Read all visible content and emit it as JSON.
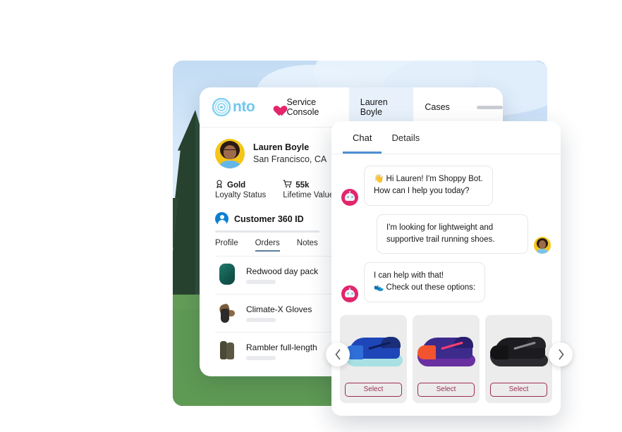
{
  "app": {
    "logo_text": "nto",
    "header_tabs": [
      {
        "label": "Service Console",
        "icon": "heart-icon",
        "active": false
      },
      {
        "label": "Lauren Boyle",
        "active": true
      },
      {
        "label": "Cases",
        "active": false
      }
    ]
  },
  "customer": {
    "name": "Lauren Boyle",
    "location": "San Francisco, CA",
    "stats": [
      {
        "icon": "badge-icon",
        "value": "Gold",
        "label": "Loyalty Status"
      },
      {
        "icon": "cart-icon",
        "value": "55k",
        "label": "Lifetime Value"
      }
    ],
    "section_title": "Customer 360 ID",
    "subtabs": [
      {
        "label": "Profile",
        "active": false
      },
      {
        "label": "Orders",
        "active": true
      },
      {
        "label": "Notes",
        "active": false
      }
    ],
    "orders": [
      {
        "name": "Redwood day pack",
        "thumb": "backpack-thumb"
      },
      {
        "name": "Climate-X Gloves",
        "thumb": "gloves-thumb"
      },
      {
        "name": "Rambler full-length",
        "thumb": "boots-thumb"
      }
    ]
  },
  "chat": {
    "tabs": [
      {
        "label": "Chat",
        "active": true
      },
      {
        "label": "Details",
        "active": false
      }
    ],
    "messages": [
      {
        "from": "bot",
        "text": "👋 Hi Lauren! I'm Shoppy Bot.\nHow can I help you today?"
      },
      {
        "from": "user",
        "text": "I'm looking for lightweight and supportive trail running shoes."
      },
      {
        "from": "bot",
        "text": "I can help with that!\n👟 Check out these options:"
      }
    ],
    "products": [
      {
        "name": "blue-trail-shoe",
        "select_label": "Select",
        "colors": {
          "sole": "#a8e0e4",
          "upper": "#1f46b8",
          "toe": "#2f6fd8",
          "collar": "#1a2e7a",
          "lace": "#0e1e5c"
        }
      },
      {
        "name": "purple-orange-trail-shoe",
        "select_label": "Select",
        "colors": {
          "sole": "#6a2fa0",
          "upper": "#3d2b8c",
          "toe": "#f25430",
          "collar": "#2a1f6e",
          "lace": "#ff3d6e"
        }
      },
      {
        "name": "black-trail-shoe",
        "select_label": "Select",
        "colors": {
          "sole": "#2b2b30",
          "upper": "#1c1c20",
          "toe": "#131316",
          "collar": "#242428",
          "lace": "#8a8a90"
        }
      }
    ],
    "carousel": {
      "prev_icon": "chevron-left-icon",
      "next_icon": "chevron-right-icon"
    }
  },
  "colors": {
    "brand_blue": "#6fc7ef",
    "accent_pink": "#e3256b",
    "select_border": "#9b2c52",
    "tab_underline": "#4a8fd4",
    "active_tab_bg": "#e8f1fb"
  }
}
